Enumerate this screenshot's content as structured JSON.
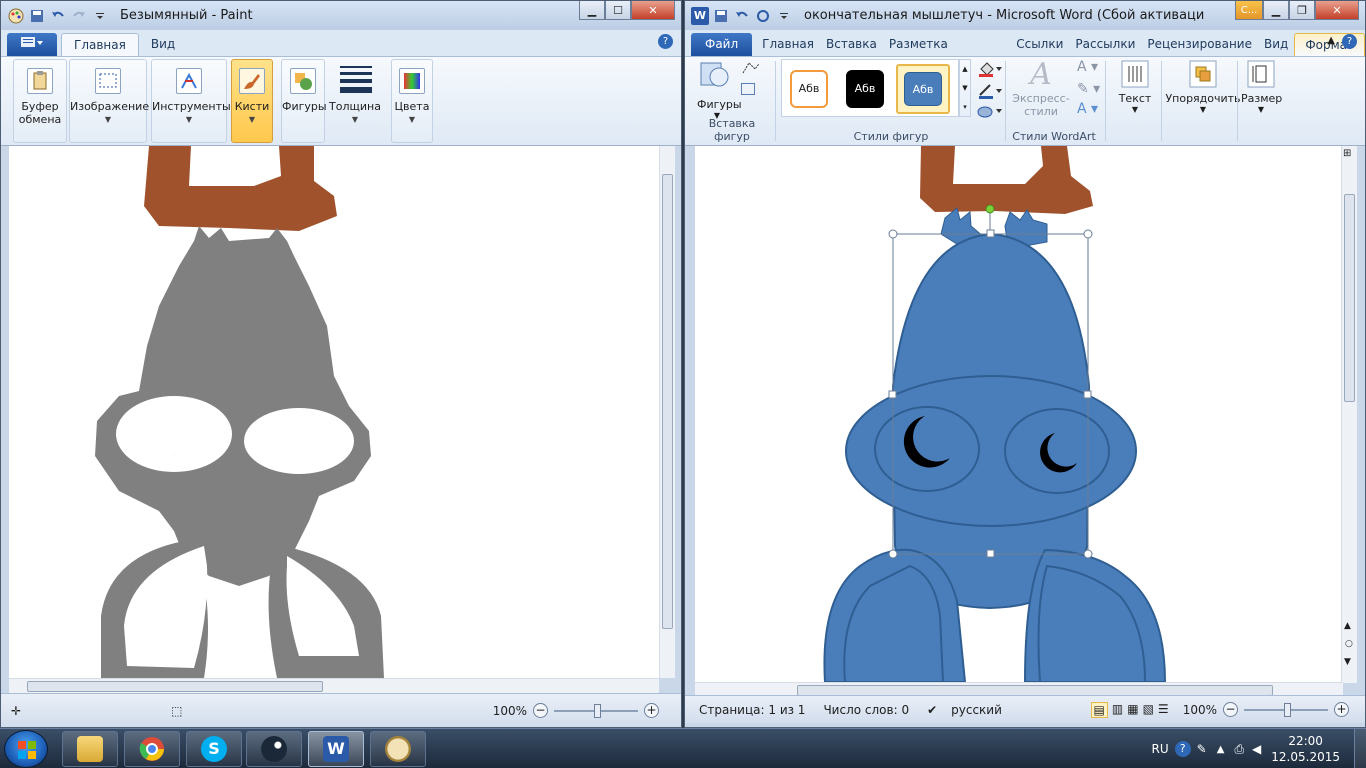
{
  "paint": {
    "title": "Безымянный - Paint",
    "tabs": [
      "Главная",
      "Вид"
    ],
    "groups": [
      {
        "label": "Буфер\nобмена",
        "line1": "Буфер",
        "line2": "обмена"
      },
      {
        "label": "Изображение"
      },
      {
        "label": "Инструменты"
      },
      {
        "label": "Кисти"
      },
      {
        "label": "Фигуры"
      },
      {
        "label": "Толщина"
      },
      {
        "label": "Цвета"
      }
    ],
    "zoom": "100%"
  },
  "word": {
    "title": "окончательная мышлетуч  -  Microsoft Word (Сбой активации проду...",
    "context_tab_short": "С...",
    "tabs": [
      "Файл",
      "Главная",
      "Вставка",
      "Разметка страницы",
      "Ссылки",
      "Рассылки",
      "Рецензирование",
      "Вид",
      "Формат"
    ],
    "groups": {
      "insert_shapes": {
        "button": "Фигуры",
        "name": "Вставка фигур"
      },
      "shape_styles": {
        "name": "Стили фигур",
        "samples": [
          "Абв",
          "Абв",
          "Абв"
        ]
      },
      "wordart": {
        "button_line1": "Экспресс-",
        "button_line2": "стили",
        "name": "Стили WordArt"
      },
      "text": {
        "button": "Текст"
      },
      "arrange": {
        "button": "Упорядочить"
      },
      "size": {
        "button": "Размер"
      }
    },
    "status": {
      "page": "Страница: 1 из 1",
      "words": "Число слов: 0",
      "language": "русский",
      "zoom": "100%"
    }
  },
  "taskbar": {
    "language": "RU",
    "time": "22:00",
    "date": "12.05.2015",
    "apps": [
      "windows-explorer-icon",
      "chrome-icon",
      "skype-icon",
      "steam-icon",
      "word-icon",
      "paint-icon"
    ]
  },
  "colors": {
    "paint_gray": "#808080",
    "brown": "#a0522d",
    "word_blue": "#4a7ebb",
    "word_outline": "#2f5e92",
    "ribbon_highlight": "#ffc84d"
  }
}
